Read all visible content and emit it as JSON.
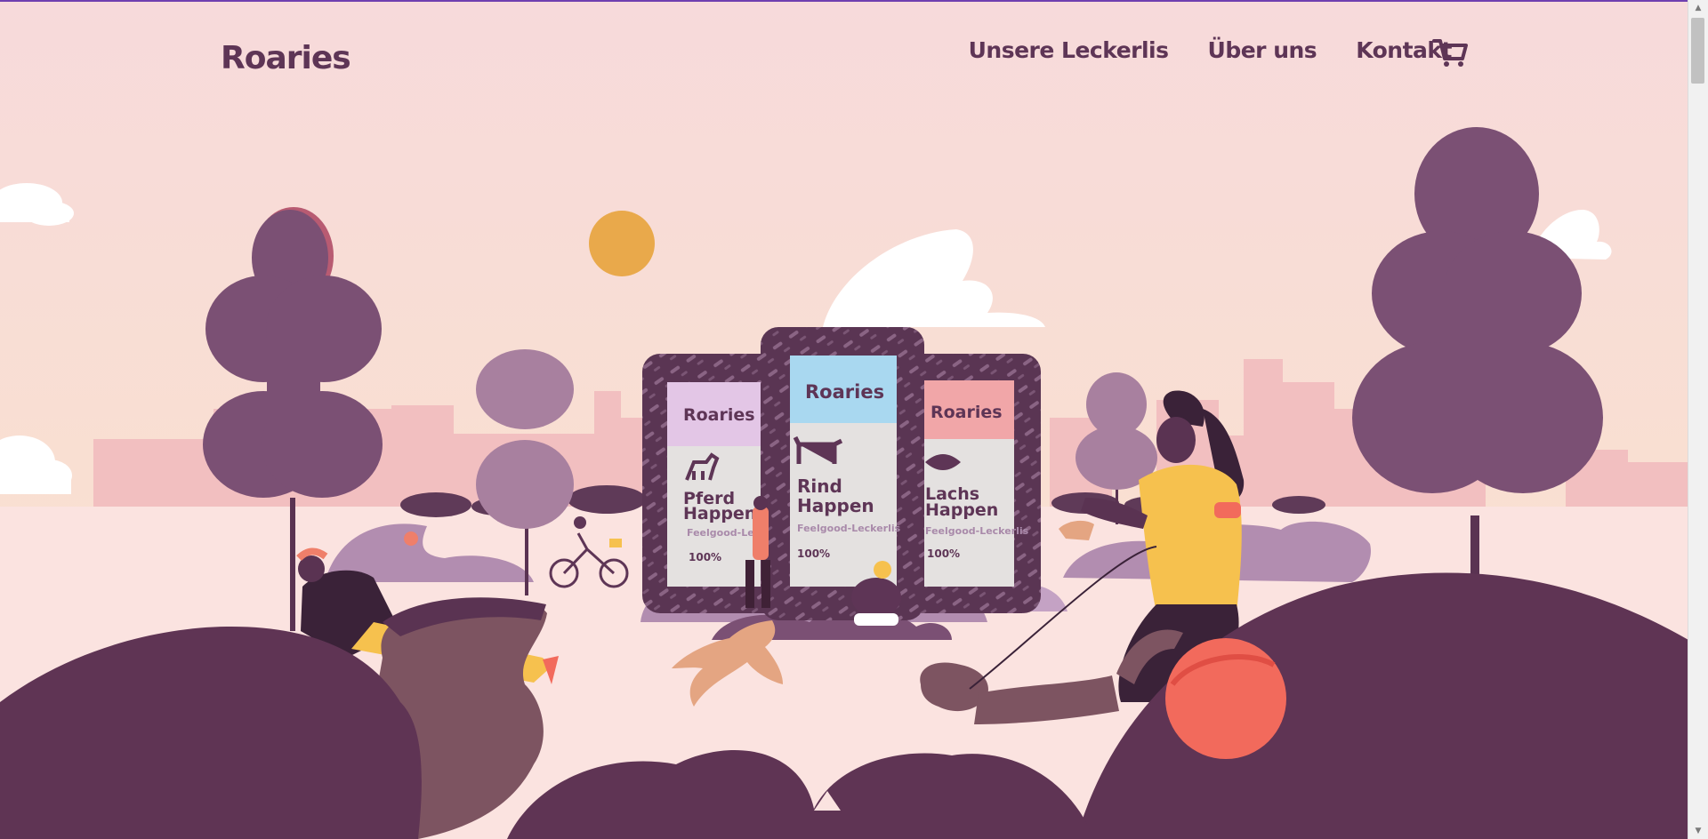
{
  "brand": {
    "name": "Roaries"
  },
  "nav": {
    "items": [
      {
        "label": "Unsere Leckerlis"
      },
      {
        "label": "Über uns"
      },
      {
        "label": "Kontakt"
      }
    ],
    "cart_icon": "shopping-cart-icon"
  },
  "products": [
    {
      "brand": "Roaries",
      "name_line1": "Pferd",
      "name_line2": "Happen",
      "tagline": "Feelgood-Leckerli",
      "badge": "100%",
      "label_color": "#e3c6e6",
      "animal_icon": "horse-icon"
    },
    {
      "brand": "Roaries",
      "name_line1": "Rind",
      "name_line2": "Happen",
      "tagline": "Feelgood-Leckerlis",
      "badge": "100%",
      "label_color": "#a9d8f0",
      "animal_icon": "cow-icon"
    },
    {
      "brand": "Roaries",
      "name_line1": "Lachs",
      "name_line2": "Happen",
      "tagline": "Feelgood-Leckerlis",
      "badge": "100%",
      "label_color": "#f1a6a8",
      "animal_icon": "fish-icon"
    }
  ],
  "colors": {
    "brand_purple": "#5e3556",
    "sky_top": "#f7dadb",
    "sky_bottom": "#f8e0cf",
    "sun": "#e9a94b",
    "tree": "#7b5074",
    "hill": "#5f3454",
    "ball": "#f26a5c",
    "runner_shirt": "#f6c14e"
  }
}
